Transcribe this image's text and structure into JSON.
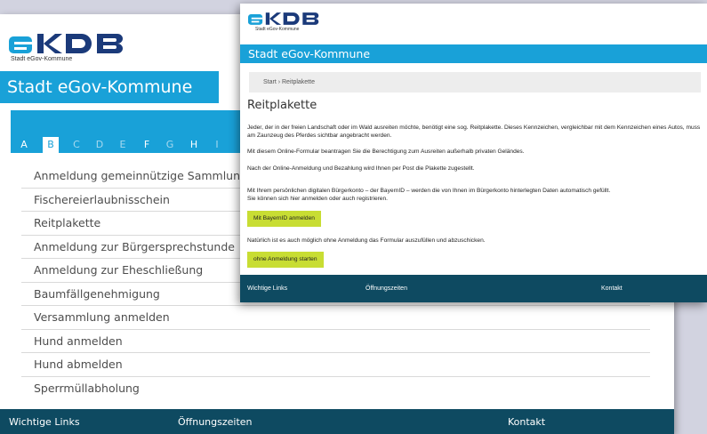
{
  "back": {
    "logo_text": "AKDB",
    "logo_sub": "Stadt eGov-Kommune",
    "title": "Stadt eGov-Kommune",
    "letters": [
      {
        "letter": "A",
        "state": "active"
      },
      {
        "letter": "B",
        "state": "selected"
      },
      {
        "letter": "C",
        "state": "dim"
      },
      {
        "letter": "D",
        "state": "dim"
      },
      {
        "letter": "E",
        "state": "dim"
      },
      {
        "letter": "F",
        "state": "active"
      },
      {
        "letter": "G",
        "state": "dim"
      },
      {
        "letter": "H",
        "state": "active"
      },
      {
        "letter": "I",
        "state": "dim"
      }
    ],
    "list": [
      "Anmeldung gemeinnützige Sammlung",
      "Fischereierlaubnisschein",
      "Reitplakette",
      "Anmeldung zur Bürgersprechstunde",
      "Anmeldung zur Eheschließung",
      "Baumfällgenehmigung",
      "Versammlung anmelden",
      "Hund anmelden",
      "Hund abmelden",
      "Sperrmüllabholung"
    ],
    "footer": {
      "links": "Wichtige Links",
      "hours": "Öffnungszeiten",
      "contact": "Kontakt"
    }
  },
  "front": {
    "logo_text": "AKDB",
    "logo_sub": "Stadt eGov-Kommune",
    "title": "Stadt eGov-Kommune",
    "breadcrumb": "Start  ›  Reitplakette",
    "page_title": "Reitplakette",
    "para1": "Jeder, der in der freien Landschaft oder im Wald ausreiten möchte, benötigt eine sog. Reitplakette. Dieses Kennzeichen, vergleichbar mit dem Kennzeichen eines Autos, muss am Zaunzeug des Pferdes sichtbar angebracht werden.",
    "para2": "Mit diesem Online-Formular beantragen Sie die Berechtigung zum Ausreiten außerhalb privaten Geländes.",
    "para3": "Nach der Online-Anmeldung und Bezahlung wird Ihnen per Post die Plakette zugestellt.",
    "para4a": "Mit Ihrem persönlichen digitalen Bürgerkonto – der BayernID – werden die von Ihnen im Bürgerkonto hinterlegten Daten automatisch gefüllt.",
    "para4b": "Sie können sich hier anmelden oder auch registrieren.",
    "btn_bayernid": "Mit BayernID anmelden",
    "para5": "Natürlich ist es auch möglich ohne Anmeldung das Formular auszufüllen und abzuschicken.",
    "btn_start": "ohne Anmeldung starten",
    "footer": {
      "links": "Wichtige Links",
      "hours": "Öffnungszeiten",
      "contact": "Kontakt"
    }
  },
  "colors": {
    "brand_blue": "#19a1d8",
    "footer_navy": "#0e4a61",
    "button_green": "#c8dd33",
    "logo_navy": "#1b3a7a",
    "logo_cyan": "#19a1d8"
  }
}
